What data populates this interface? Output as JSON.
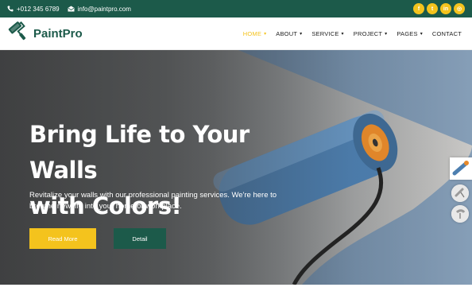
{
  "topbar": {
    "phone": "+012 345 6789",
    "email": "info@paintpro.com",
    "socials": [
      {
        "name": "facebook",
        "glyph": "f"
      },
      {
        "name": "twitter",
        "glyph": "t"
      },
      {
        "name": "linkedin",
        "glyph": "in"
      },
      {
        "name": "instagram",
        "glyph": "◎"
      }
    ]
  },
  "brand": {
    "name": "PaintPro"
  },
  "nav": {
    "items": [
      {
        "label": "HOME",
        "active": true
      },
      {
        "label": "ABOUT",
        "active": false
      },
      {
        "label": "SERVICE",
        "active": false
      },
      {
        "label": "PROJECT",
        "active": false
      },
      {
        "label": "PAGES",
        "active": false
      },
      {
        "label": "CONTACT",
        "active": false
      }
    ]
  },
  "hero": {
    "title_line1": "Bring Life to Your Walls",
    "title_line2": "with Colors!",
    "subtitle": "Revitalize your walls with our professional painting services. We're here to breathe new life into your home or workplace.",
    "primary_button": "Read More",
    "secondary_button": "Detail"
  },
  "colors": {
    "brand_green": "#1c5a4a",
    "accent_yellow": "#f4c31d",
    "roller_blue": "#4d7fb0"
  }
}
